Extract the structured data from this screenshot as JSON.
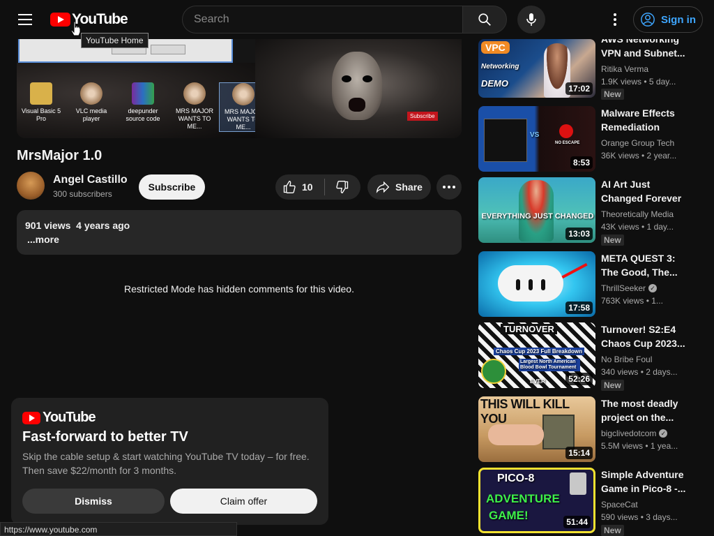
{
  "header": {
    "logo_text": "YouTube",
    "tooltip": "YouTube Home",
    "search_placeholder": "Search",
    "signin_label": "Sign in"
  },
  "video": {
    "title": "MrsMajor 1.0",
    "overlay_subscribe": "Subscribe",
    "desktop_icons": [
      {
        "label": "Visual Basic 5 Pro",
        "icon": "folder-icon"
      },
      {
        "label": "VLC media player",
        "icon": "skull-icon"
      },
      {
        "label": "deepunder source code",
        "icon": "winrar-icon"
      },
      {
        "label": "MRS MAJOR WANTS TO ME...",
        "icon": "skull-icon"
      },
      {
        "label": "MRS MAJOR WANTS TO ME...",
        "icon": "skull-icon"
      }
    ]
  },
  "channel": {
    "name": "Angel Castillo",
    "subscribers": "300 subscribers",
    "subscribe_label": "Subscribe"
  },
  "actions": {
    "likes": "10",
    "share_label": "Share"
  },
  "description": {
    "views": "901 views",
    "age": "4 years ago",
    "more": "...more"
  },
  "comments_notice": "Restricted Mode has hidden comments for this video.",
  "promo": {
    "logo_text": "YouTube",
    "headline": "Fast-forward to better TV",
    "body": "Skip the cable setup & start watching YouTube TV today – for free. Then save $22/month for 3 months.",
    "dismiss_label": "Dismiss",
    "claim_label": "Claim offer"
  },
  "status_url": "https://www.youtube.com",
  "recommendations": [
    {
      "title": "AWS Networking VPN and Subnet...",
      "channel": "Ritika Verma",
      "verified": false,
      "meta": "1.9K views • 5 day...",
      "duration": "17:02",
      "badge": "New",
      "thumb_text": [
        "VPC",
        "Networking",
        "DEMO"
      ]
    },
    {
      "title": "Malware Effects Remediation Too...",
      "channel": "Orange Group Tech",
      "verified": false,
      "meta": "36K views • 2 year...",
      "duration": "8:53",
      "badge": "",
      "thumb_text": [
        "VS",
        "NO ESCAPE"
      ]
    },
    {
      "title": "AI Art Just Changed Forever",
      "channel": "Theoretically Media",
      "verified": false,
      "meta": "43K views • 1 day...",
      "duration": "13:03",
      "badge": "New",
      "thumb_text": [
        "EVERYTHING JUST CHANGED"
      ]
    },
    {
      "title": "META QUEST 3: The Good, The...",
      "channel": "ThrillSeeker",
      "verified": true,
      "meta": "763K views • 1...",
      "duration": "17:58",
      "badge": "",
      "thumb_text": []
    },
    {
      "title": "Turnover! S2:E4 Chaos Cup 2023...",
      "channel": "No Bribe Foul",
      "verified": false,
      "meta": "340 views • 2 days...",
      "duration": "52:26",
      "badge": "New",
      "thumb_text": [
        "TURNOVER",
        "Chaos Cup 2023 Full Breakdown",
        "Largest North American Blood Bowl Tournament",
        "EVER"
      ]
    },
    {
      "title": "The most deadly project on the...",
      "channel": "bigclivedotcom",
      "verified": true,
      "meta": "5.5M views • 1 yea...",
      "duration": "15:14",
      "badge": "",
      "thumb_text": [
        "THIS WILL KILL YOU"
      ]
    },
    {
      "title": "Simple Adventure Game in Pico-8 -...",
      "channel": "SpaceCat",
      "verified": false,
      "meta": "590 views • 3 days...",
      "duration": "51:44",
      "badge": "New",
      "thumb_text": [
        "PICO-8",
        "ADVENTURE",
        "GAME!"
      ]
    }
  ],
  "colors": {
    "background": "#0f0f0f",
    "surface": "#272727",
    "brand_red": "#ff0000",
    "link_blue": "#3ea6ff",
    "text_secondary": "#aaaaaa"
  }
}
